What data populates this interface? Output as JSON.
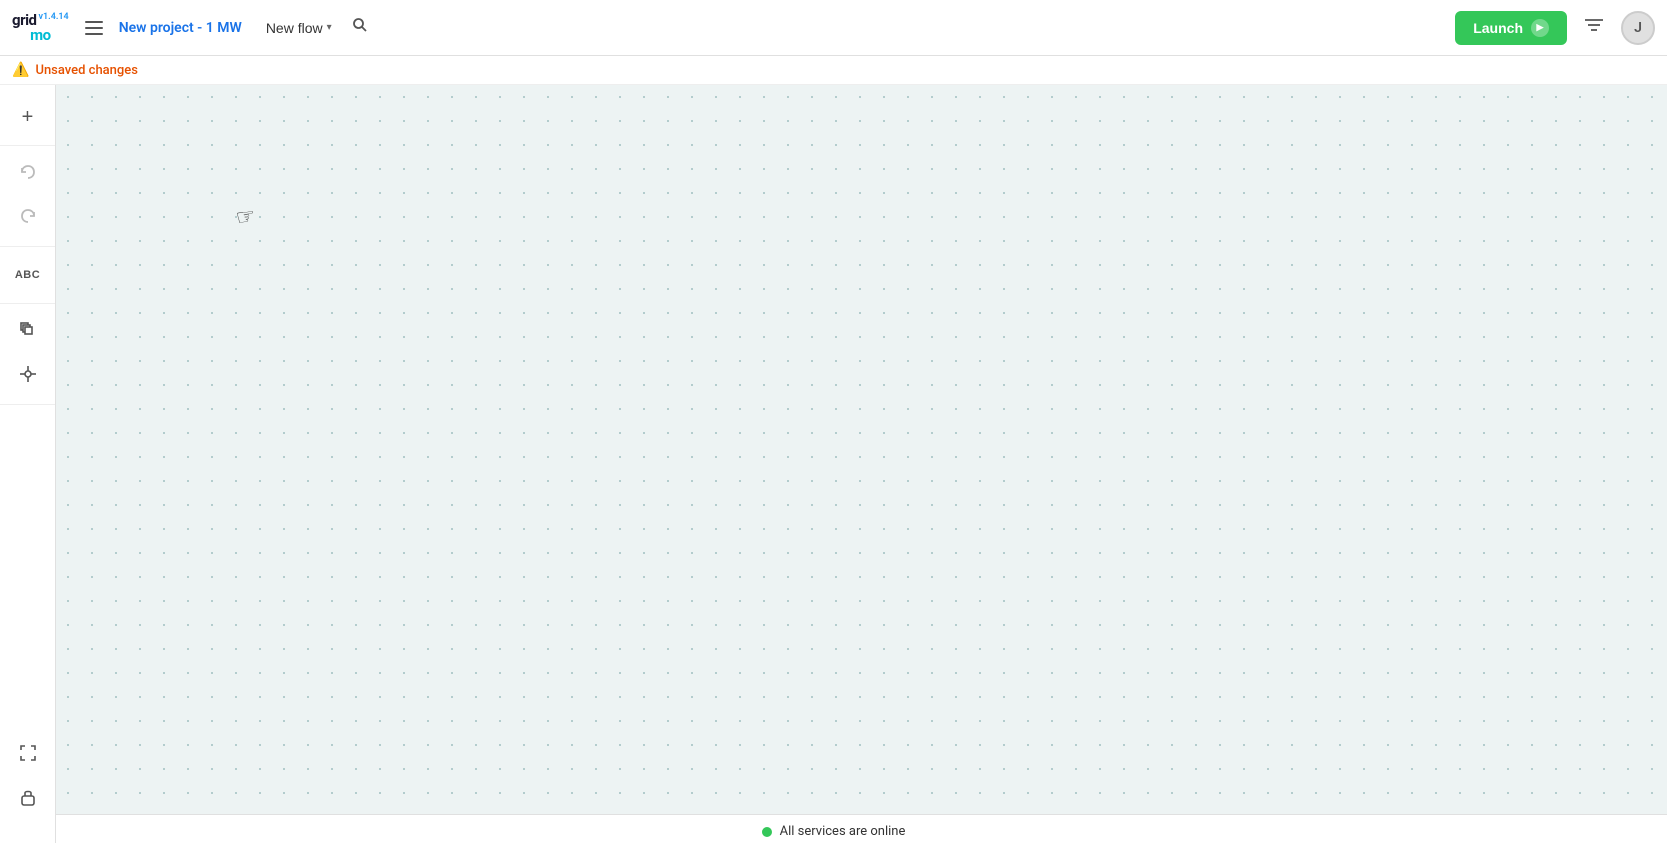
{
  "app": {
    "name_grid": "grid",
    "name_mo": "mo",
    "version": "v1.4.14"
  },
  "header": {
    "project_name": "New project - 1 MW",
    "flow_label": "New flow",
    "search_label": "Search",
    "launch_label": "Launch",
    "avatar_initial": "J"
  },
  "unsaved": {
    "text": "Unsaved changes"
  },
  "toolbar": {
    "zoom_in_label": "+",
    "undo_label": "↺",
    "redo_label": "↻",
    "abc_label": "ABC",
    "layers_label": "⊞",
    "node_label": "✛",
    "fit_label": "⤢",
    "lock_label": "🔒"
  },
  "status": {
    "text": "All services are online"
  },
  "colors": {
    "launch_green": "#34c759",
    "link_blue": "#1a73e8",
    "warning_orange": "#e65100",
    "dot_green": "#34c759"
  }
}
